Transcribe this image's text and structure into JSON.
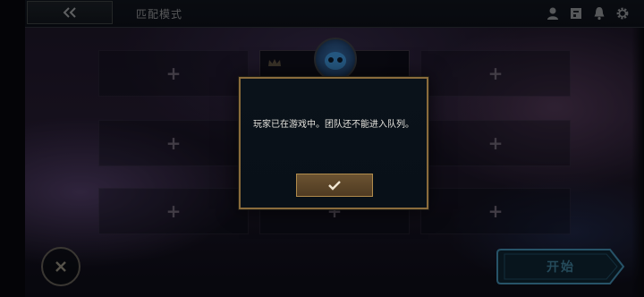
{
  "header": {
    "title": "匹配模式",
    "back_icon": "double-chevron-left-icon",
    "right_icons": [
      "profile-icon",
      "store-icon",
      "notification-bell-icon",
      "settings-gear-icon"
    ]
  },
  "lobby": {
    "slots": [
      {
        "icon": "plus-icon",
        "glyph": "+"
      },
      {
        "icon": "plus-icon",
        "glyph": "+"
      },
      {
        "icon": "plus-icon",
        "glyph": "+"
      },
      {
        "icon": "plus-icon",
        "glyph": "+"
      },
      {
        "icon": "plus-icon",
        "glyph": "+"
      },
      {
        "icon": "plus-icon",
        "glyph": "+"
      },
      {
        "icon": "plus-icon",
        "glyph": "+"
      },
      {
        "icon": "plus-icon",
        "glyph": "+"
      }
    ],
    "owner_icon": "crown-icon"
  },
  "footer": {
    "close_icon": "close-x-icon",
    "start_label": "开始"
  },
  "dialog": {
    "message": "玩家已在游戏中。团队还不能进入队列。",
    "confirm_icon": "checkmark-icon"
  },
  "colors": {
    "gold_border": "#8a6c3c",
    "confirm_fill": "#5e4629",
    "start_outline": "#3f86a8"
  }
}
